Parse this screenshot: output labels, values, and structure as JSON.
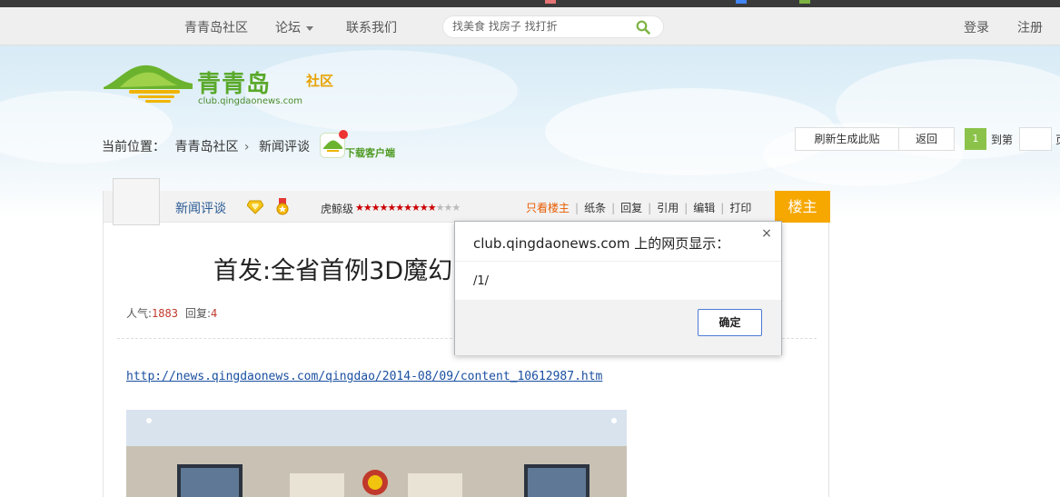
{
  "topbar": {
    "nav": [
      {
        "label": "青青岛社区"
      },
      {
        "label": "论坛"
      },
      {
        "label": "联系我们"
      }
    ],
    "search_placeholder": "找美食 找房子 找打折",
    "login": "登录",
    "register": "注册"
  },
  "logo": {
    "name": "青青岛",
    "tag": "社区",
    "url": "club.qingdaonews.com"
  },
  "breadcrumb": {
    "prefix": "当前位置：",
    "items": [
      "青青岛社区",
      "新闻评谈"
    ],
    "client_label": "下载客户端"
  },
  "actions": {
    "regenerate": "刷新生成此贴",
    "back": "返回",
    "page_current": "1",
    "goto": "到第",
    "goto_suffix": "页"
  },
  "post": {
    "forum": "新闻评谈",
    "rank_label": "虎鲸级",
    "stars_filled": "★★★★★★★★★★",
    "stars_empty": "★★★",
    "tools": [
      "只看楼主",
      "纸条",
      "回复",
      "引用",
      "编辑",
      "打印"
    ],
    "floor": "楼主",
    "title": "首发:全省首例3D魔幻",
    "popularity_label": "人气:",
    "popularity": "1883",
    "replies_label": "回复:",
    "replies": "4",
    "link": "http://news.qingdaonews.com/qingdao/2014-08/09/content_10612987.htm"
  },
  "dialog": {
    "title": "club.qingdaonews.com 上的网页显示：",
    "message": "/1/",
    "ok": "确定",
    "close": "×"
  },
  "colors": {
    "accent_green": "#8bc34a",
    "floor_orange": "#f7a800",
    "link_blue": "#1a4fa0",
    "logo_green": "#5aa92b"
  }
}
